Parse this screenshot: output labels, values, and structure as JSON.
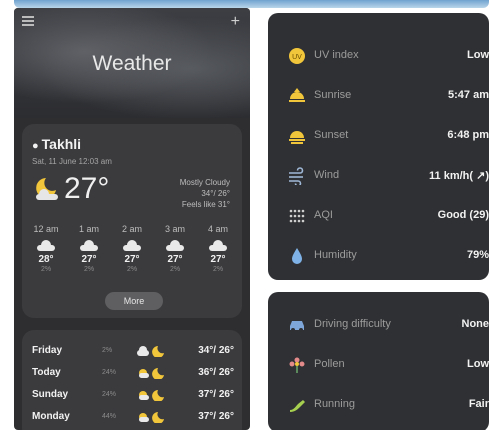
{
  "left": {
    "title": "Weather",
    "location": "Takhli",
    "datetime": "Sat, 11 June 12:03 am",
    "temperature": "27°",
    "condition": "Mostly Cloudy",
    "hi_lo": "34°/ 26°",
    "feels_like": "Feels like 31°",
    "hourly": [
      {
        "time": "12 am",
        "temp": "28°",
        "precip": "2%"
      },
      {
        "time": "1 am",
        "temp": "27°",
        "precip": "2%"
      },
      {
        "time": "2 am",
        "temp": "27°",
        "precip": "2%"
      },
      {
        "time": "3 am",
        "temp": "27°",
        "precip": "2%"
      },
      {
        "time": "4 am",
        "temp": "27°",
        "precip": "2%"
      }
    ],
    "more_label": "More",
    "daily": [
      {
        "day": "Friday",
        "precip": "2%",
        "temps": "34°/ 26°"
      },
      {
        "day": "Today",
        "precip": "24%",
        "temps": "36°/ 26°"
      },
      {
        "day": "Sunday",
        "precip": "24%",
        "temps": "37°/ 26°"
      },
      {
        "day": "Monday",
        "precip": "44%",
        "temps": "37°/ 26°"
      }
    ]
  },
  "right": {
    "details": [
      {
        "label": "UV index",
        "value": "Low",
        "icon": "uv-icon"
      },
      {
        "label": "Sunrise",
        "value": "5:47 am",
        "icon": "sunrise-icon"
      },
      {
        "label": "Sunset",
        "value": "6:48 pm",
        "icon": "sunset-icon"
      },
      {
        "label": "Wind",
        "value": "11 km/h( ↗)",
        "icon": "wind-icon"
      },
      {
        "label": "AQI",
        "value": "Good (29)",
        "icon": "aqi-icon"
      },
      {
        "label": "Humidity",
        "value": "79%",
        "icon": "humidity-icon"
      }
    ],
    "lifestyle": [
      {
        "label": "Driving difficulty",
        "value": "None",
        "icon": "car-icon"
      },
      {
        "label": "Pollen",
        "value": "Low",
        "icon": "pollen-icon"
      },
      {
        "label": "Running",
        "value": "Fair",
        "icon": "running-icon"
      }
    ]
  },
  "colors": {
    "accent_yellow": "#f2c63a",
    "panel": "#2f3033",
    "card": "#3b3b3e"
  }
}
